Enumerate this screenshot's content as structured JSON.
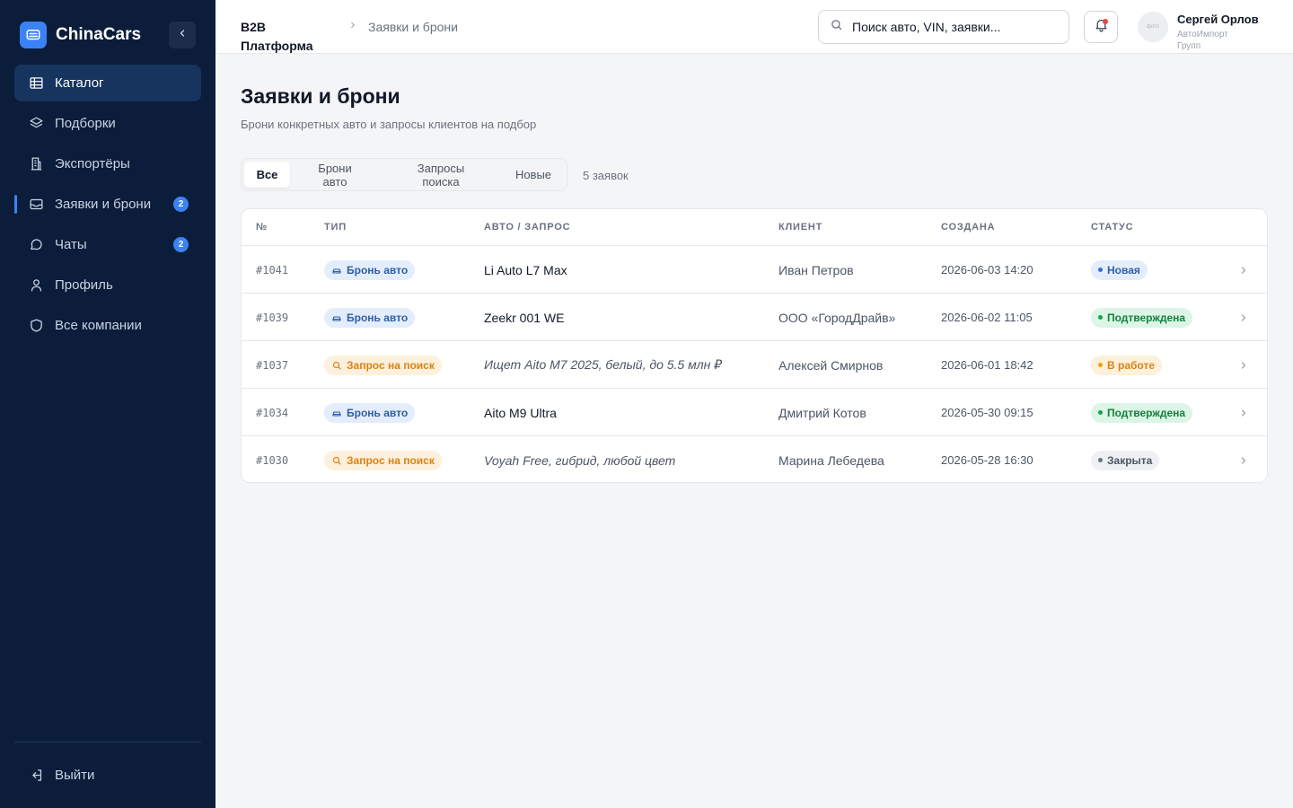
{
  "brand": {
    "name": "ChinaCars"
  },
  "sidebar": {
    "items": [
      {
        "label": "Каталог",
        "icon": "grid-icon"
      },
      {
        "label": "Подборки",
        "icon": "layers-icon"
      },
      {
        "label": "Экспортёры",
        "icon": "building-icon"
      },
      {
        "label": "Заявки и брони",
        "icon": "inbox-icon",
        "badge": "2"
      },
      {
        "label": "Чаты",
        "icon": "chat-icon",
        "badge": "2"
      },
      {
        "label": "Профиль",
        "icon": "user-icon"
      },
      {
        "label": "Все компании",
        "icon": "shield-icon"
      }
    ],
    "logout": "Выйти"
  },
  "header": {
    "breadcrumb_root": "B2B Платформа",
    "breadcrumb_current": "Заявки и брони",
    "search_placeholder": "Поиск авто, VIN, заявки...",
    "user": {
      "name": "Сергей Орлов",
      "company": "АвтоИмпорт Групп",
      "avatar_text": "фото"
    }
  },
  "main": {
    "title": "Заявки и брони",
    "subtitle": "Брони конкретных авто и запросы клиентов на подбор",
    "tabs": [
      {
        "label": "Все"
      },
      {
        "label": "Брони авто"
      },
      {
        "label": "Запросы поиска"
      },
      {
        "label": "Новые"
      }
    ],
    "count_text": "5 заявок",
    "table": {
      "columns": [
        "№",
        "ТИП",
        "АВТО / ЗАПРОС",
        "КЛИЕНТ",
        "СОЗДАНА",
        "СТАТУС"
      ],
      "rows": [
        {
          "num": "#1041",
          "type": "Бронь авто",
          "subject": "Li Auto L7 Max",
          "client": "Иван Петров",
          "created": "2026-06-03 14:20",
          "status": "Новая"
        },
        {
          "num": "#1039",
          "type": "Бронь авто",
          "subject": "Zeekr 001 WE",
          "client": "ООО «ГородДрайв»",
          "created": "2026-06-02 11:05",
          "status": "Подтверждена"
        },
        {
          "num": "#1037",
          "type": "Запрос на поиск",
          "subject": "Ищет Aito M7 2025, белый, до 5.5 млн ₽",
          "client": "Алексей Смирнов",
          "created": "2026-06-01 18:42",
          "status": "В работе"
        },
        {
          "num": "#1034",
          "type": "Бронь авто",
          "subject": "Aito M9 Ultra",
          "client": "Дмитрий Котов",
          "created": "2026-05-30 09:15",
          "status": "Подтверждена"
        },
        {
          "num": "#1030",
          "type": "Запрос на поиск",
          "subject": "Voyah Free, гибрид, любой цвет",
          "client": "Марина Лебедева",
          "created": "2026-05-28 16:30",
          "status": "Закрыта"
        }
      ]
    }
  },
  "colors": {
    "sidebar_bg": "#0b1d3a",
    "accent": "#3b82f6",
    "notification": "#ef4444"
  }
}
